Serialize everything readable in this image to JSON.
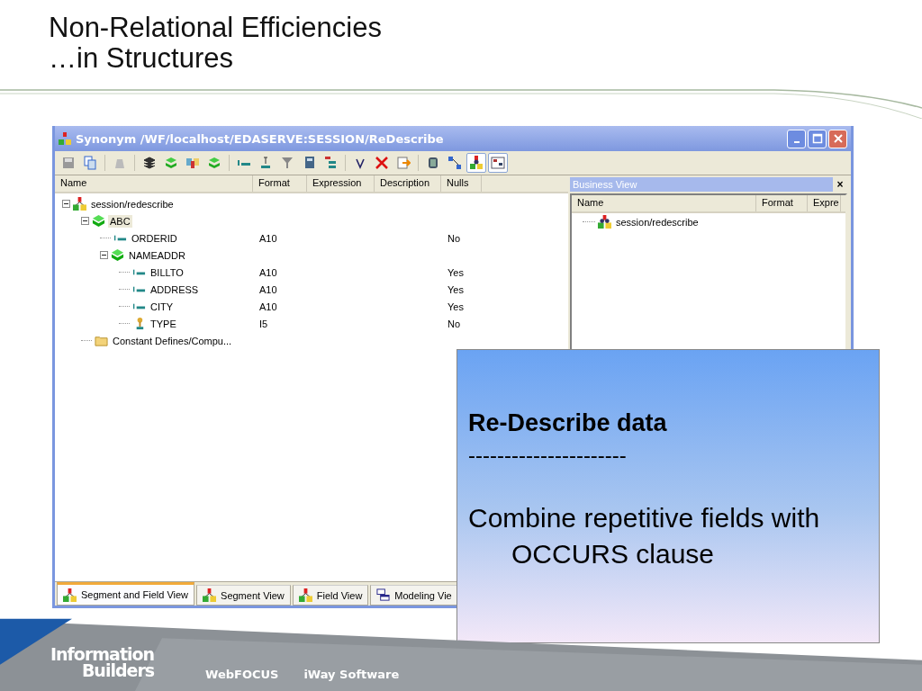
{
  "slide": {
    "title_lines": [
      "Non-Relational Efficiencies",
      "…in Structures"
    ]
  },
  "window": {
    "title": "Synonym /WF/localhost/EDASERVE:SESSION/ReDescribe"
  },
  "toolbar": [
    [
      {
        "kind": "save",
        "pressed": false
      },
      {
        "kind": "copy",
        "pressed": false
      }
    ],
    [
      {
        "kind": "disabled",
        "pressed": false
      }
    ],
    [
      {
        "kind": "stack",
        "pressed": false
      },
      {
        "kind": "segment",
        "pressed": false
      },
      {
        "kind": "join",
        "pressed": false
      },
      {
        "kind": "segment",
        "pressed": false
      }
    ],
    [
      {
        "kind": "field",
        "pressed": false
      },
      {
        "kind": "define",
        "pressed": false
      },
      {
        "kind": "filter",
        "pressed": false
      },
      {
        "kind": "calc",
        "pressed": false
      },
      {
        "kind": "tree",
        "pressed": false
      }
    ],
    [
      {
        "kind": "variable",
        "pressed": false
      },
      {
        "kind": "delete",
        "pressed": false
      },
      {
        "kind": "export",
        "pressed": false
      }
    ],
    [
      {
        "kind": "database",
        "pressed": false
      },
      {
        "kind": "diagram",
        "pressed": false
      },
      {
        "kind": "business",
        "pressed": true
      },
      {
        "kind": "panel",
        "pressed": true
      }
    ]
  ],
  "columns": [
    "Name",
    "Format",
    "Expression",
    "Description",
    "Nulls"
  ],
  "tree": [
    {
      "kind": "root",
      "name": "session/redescribe",
      "expanded": true,
      "selected": false,
      "children": [
        {
          "kind": "segment",
          "name": "ABC",
          "expanded": true,
          "selected": true,
          "children": [
            {
              "kind": "field",
              "name": "ORDERID",
              "format": "A10",
              "nulls": "No"
            },
            {
              "kind": "segment",
              "name": "NAMEADDR",
              "expanded": true,
              "selected": false,
              "children": [
                {
                  "kind": "field",
                  "name": "BILLTO",
                  "format": "A10",
                  "nulls": "Yes"
                },
                {
                  "kind": "field",
                  "name": "ADDRESS",
                  "format": "A10",
                  "nulls": "Yes"
                },
                {
                  "kind": "field",
                  "name": "CITY",
                  "format": "A10",
                  "nulls": "Yes"
                },
                {
                  "kind": "key",
                  "name": "TYPE",
                  "format": "I5",
                  "nulls": "No"
                }
              ]
            }
          ]
        },
        {
          "kind": "folder",
          "name": "Constant Defines/Compu..."
        }
      ]
    }
  ],
  "business_view": {
    "title": "Business View",
    "close": "×",
    "columns": [
      "Name",
      "Format",
      "Expre"
    ],
    "items": [
      {
        "kind": "business",
        "name": "session/redescribe"
      }
    ]
  },
  "tabs": [
    {
      "kind": "hier",
      "label": "Segment and Field View",
      "selected": true
    },
    {
      "kind": "hier",
      "label": "Segment View",
      "selected": false
    },
    {
      "kind": "hier",
      "label": "Field View",
      "selected": false
    },
    {
      "kind": "model",
      "label": "Modeling Vie",
      "selected": false
    }
  ],
  "callout": {
    "heading": "Re-Describe data",
    "rule": "----------------------",
    "body": "Combine repetitive fields with OCCURS clause"
  },
  "footer": {
    "logo_lines": [
      "Information",
      "Builders"
    ],
    "links": [
      "WebFOCUS",
      "iWay Software"
    ]
  }
}
